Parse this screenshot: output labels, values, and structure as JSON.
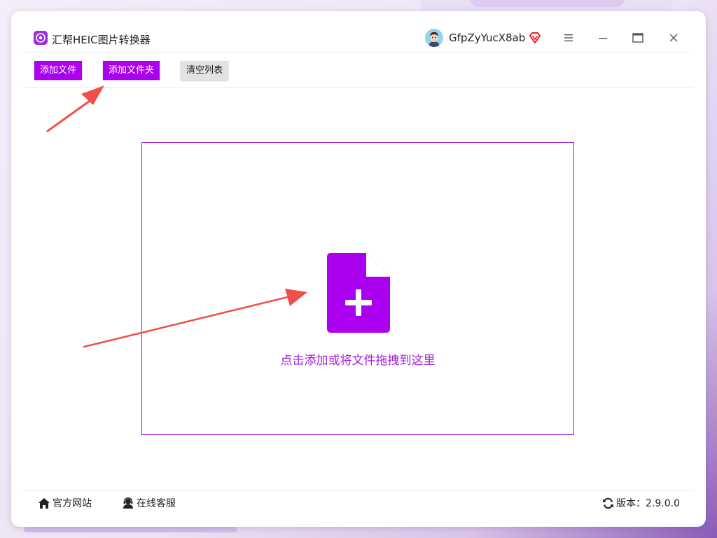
{
  "app": {
    "title": "汇帮HEIC图片转换器"
  },
  "user": {
    "name": "GfpZyYucX8ab"
  },
  "toolbar": {
    "add_file_label": "添加文件",
    "add_folder_label": "添加文件夹",
    "clear_list_label": "清空列表"
  },
  "dropzone": {
    "hint": "点击添加或将文件拖拽到这里"
  },
  "statusbar": {
    "website_label": "官方网站",
    "support_label": "在线客服",
    "version_label": "版本：2.9.0.0"
  },
  "colors": {
    "primary": "#ab00f0",
    "hint_text": "#a01ed8",
    "annotation_arrow": "#f0504c",
    "vip_badge": "#e8242c"
  },
  "icons": {
    "app": "app-logo-icon",
    "vip": "vip-diamond-icon",
    "menu": "hamburger-menu-icon",
    "minimize": "minimize-icon",
    "maximize": "maximize-icon",
    "close": "close-icon",
    "file_add": "file-add-icon",
    "home": "home-icon",
    "support": "headset-icon",
    "refresh": "refresh-icon"
  }
}
